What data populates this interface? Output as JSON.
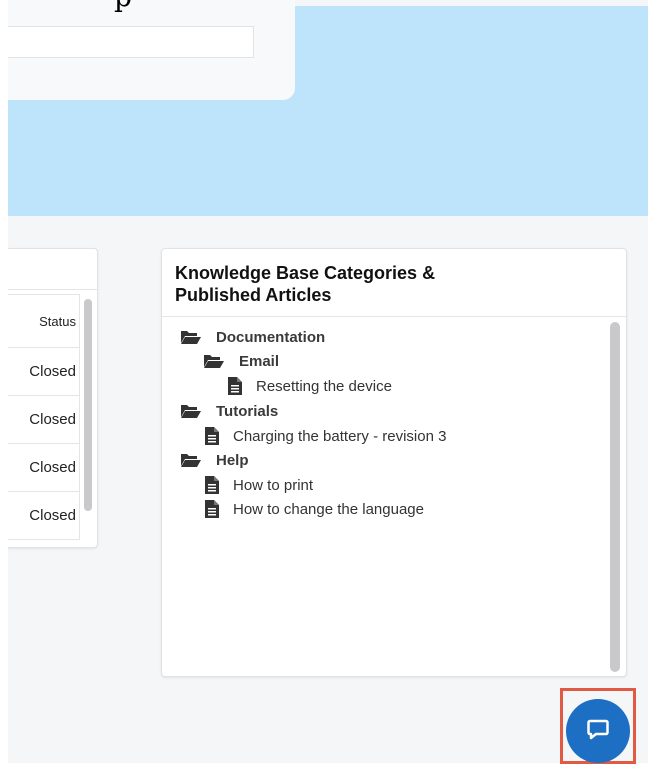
{
  "search": {
    "title_fragment": "p"
  },
  "cases_table": {
    "column_header": "Status",
    "rows": [
      {
        "status": "Closed"
      },
      {
        "status": "Closed"
      },
      {
        "status": "Closed"
      },
      {
        "status": "Closed"
      }
    ]
  },
  "knowledge_base": {
    "title_line1": "Knowledge Base Categories &",
    "title_line2": "Published Articles",
    "tree": [
      {
        "type": "folder",
        "label": "Documentation",
        "icon": "folder-open-icon"
      },
      {
        "type": "folder",
        "label": "Email",
        "icon": "folder-open-icon"
      },
      {
        "type": "article",
        "label": "Resetting the device",
        "icon": "file-text-icon"
      },
      {
        "type": "folder",
        "label": "Tutorials",
        "icon": "folder-open-icon"
      },
      {
        "type": "article",
        "label": "Charging the battery - revision 3",
        "icon": "file-text-icon"
      },
      {
        "type": "folder",
        "label": "Help",
        "icon": "folder-open-icon"
      },
      {
        "type": "article",
        "label": "How to print",
        "icon": "file-text-icon"
      },
      {
        "type": "article",
        "label": "How to change the language",
        "icon": "file-text-icon"
      }
    ]
  },
  "chat": {
    "icon": "chat-bubble-icon",
    "highlight_color": "#e05a44",
    "button_color": "#1d6fc4"
  }
}
